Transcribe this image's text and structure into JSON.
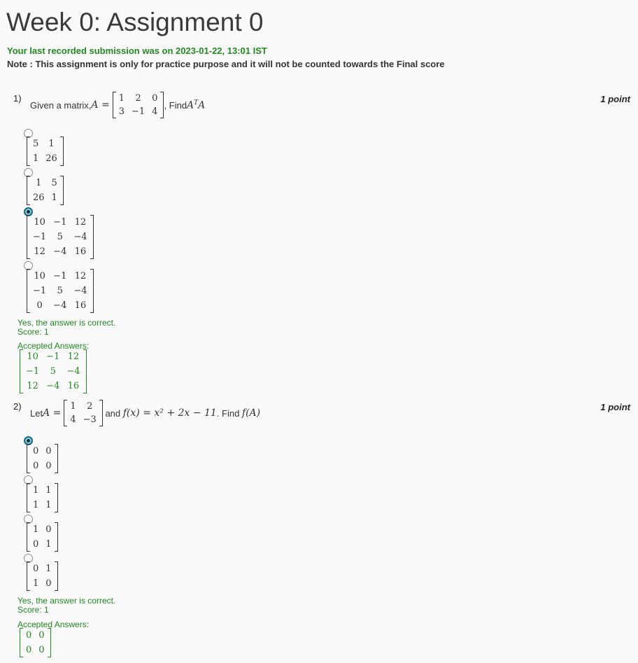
{
  "page": {
    "title": "Week 0: Assignment 0",
    "submission_text": "Your last recorded submission was on 2023-01-22, 13:01 IST",
    "note_text": "Note : This assignment is only for practice purpose and it will not be counted towards the Final score"
  },
  "q1": {
    "number": "1)",
    "points": "1 point",
    "prefix": "Given a matrix, ",
    "lhs": "A =",
    "matrix": [
      [
        "1",
        "2",
        "0"
      ],
      [
        "3",
        "−1",
        "4"
      ]
    ],
    "suffix": ", Find ",
    "expr": "A",
    "expr_sup": "T",
    "expr_tail": "A",
    "options": [
      {
        "matrix": [
          [
            "5",
            "1"
          ],
          [
            "1",
            "26"
          ]
        ],
        "checked": false
      },
      {
        "matrix": [
          [
            "1",
            "5"
          ],
          [
            "26",
            "1"
          ]
        ],
        "checked": false
      },
      {
        "matrix": [
          [
            "10",
            "−1",
            "12"
          ],
          [
            "−1",
            "5",
            "−4"
          ],
          [
            "12",
            "−4",
            "16"
          ]
        ],
        "checked": true
      },
      {
        "matrix": [
          [
            "10",
            "−1",
            "12"
          ],
          [
            "−1",
            "5",
            "−4"
          ],
          [
            "0",
            "−4",
            "16"
          ]
        ],
        "checked": false
      }
    ],
    "feedback": "Yes, the answer is correct.",
    "score": "Score: 1",
    "accepted_label": "Accepted Answers:",
    "accepted_matrix": [
      [
        "10",
        "−1",
        "12"
      ],
      [
        "−1",
        "5",
        "−4"
      ],
      [
        "12",
        "−4",
        "16"
      ]
    ]
  },
  "q2": {
    "number": "2)",
    "points": "1 point",
    "prefix": "Let ",
    "lhs": "A =",
    "matrix": [
      [
        "1",
        "2"
      ],
      [
        "4",
        "−3"
      ]
    ],
    "mid": " and ",
    "func": "f(x) = x² + 2x − 11",
    "suffix": ". Find ",
    "expr": "f(A)",
    "options": [
      {
        "matrix": [
          [
            "0",
            "0"
          ],
          [
            "0",
            "0"
          ]
        ],
        "checked": true
      },
      {
        "matrix": [
          [
            "1",
            "1"
          ],
          [
            "1",
            "1"
          ]
        ],
        "checked": false
      },
      {
        "matrix": [
          [
            "1",
            "0"
          ],
          [
            "0",
            "1"
          ]
        ],
        "checked": false
      },
      {
        "matrix": [
          [
            "0",
            "1"
          ],
          [
            "1",
            "0"
          ]
        ],
        "checked": false
      }
    ],
    "feedback": "Yes, the answer is correct.",
    "score": "Score: 1",
    "accepted_label": "Accepted Answers:",
    "accepted_matrix": [
      [
        "0",
        "0"
      ],
      [
        "0",
        "0"
      ]
    ]
  }
}
